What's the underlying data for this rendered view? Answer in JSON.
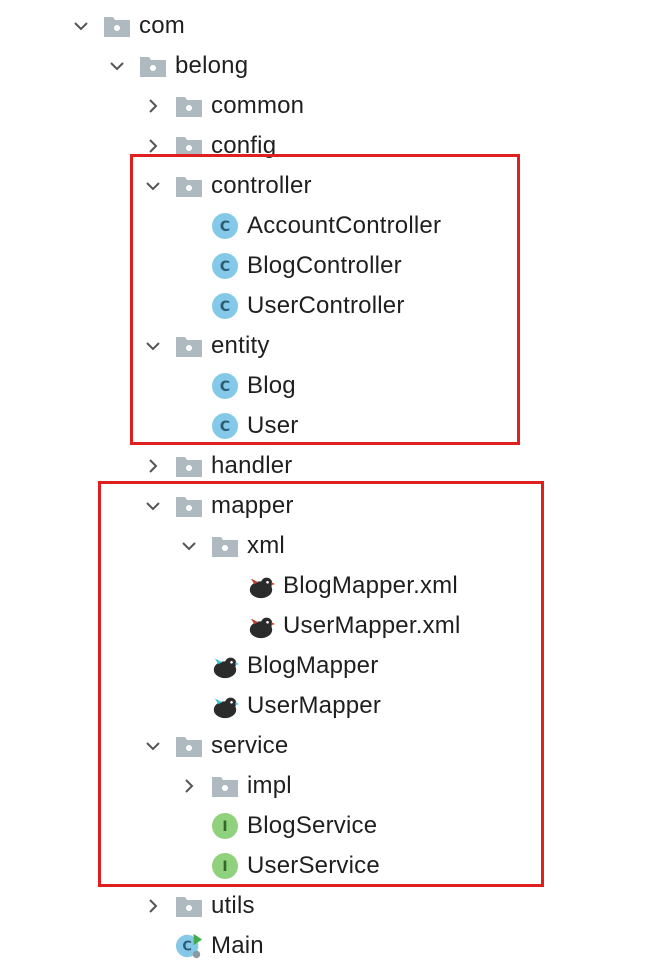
{
  "tree": {
    "items": [
      {
        "label": "com",
        "kind": "folder",
        "expanded": true
      },
      {
        "label": "belong",
        "kind": "folder",
        "expanded": true
      },
      {
        "label": "common",
        "kind": "folder",
        "expanded": false
      },
      {
        "label": "config",
        "kind": "folder",
        "expanded": false
      },
      {
        "label": "controller",
        "kind": "folder",
        "expanded": true
      },
      {
        "label": "AccountController",
        "kind": "class"
      },
      {
        "label": "BlogController",
        "kind": "class"
      },
      {
        "label": "UserController",
        "kind": "class"
      },
      {
        "label": "entity",
        "kind": "folder",
        "expanded": true
      },
      {
        "label": "Blog",
        "kind": "class"
      },
      {
        "label": "User",
        "kind": "class"
      },
      {
        "label": "handler",
        "kind": "folder",
        "expanded": false
      },
      {
        "label": "mapper",
        "kind": "folder",
        "expanded": true
      },
      {
        "label": "xml",
        "kind": "folder",
        "expanded": true
      },
      {
        "label": "BlogMapper.xml",
        "kind": "mybatis-xml"
      },
      {
        "label": "UserMapper.xml",
        "kind": "mybatis-xml"
      },
      {
        "label": "BlogMapper",
        "kind": "mybatis-mapper"
      },
      {
        "label": "UserMapper",
        "kind": "mybatis-mapper"
      },
      {
        "label": "service",
        "kind": "folder",
        "expanded": true
      },
      {
        "label": "impl",
        "kind": "folder",
        "expanded": false
      },
      {
        "label": "BlogService",
        "kind": "interface"
      },
      {
        "label": "UserService",
        "kind": "interface"
      },
      {
        "label": "utils",
        "kind": "folder",
        "expanded": false
      },
      {
        "label": "Main",
        "kind": "main-class"
      }
    ]
  },
  "icons": {
    "class_glyph": "C",
    "interface_glyph": "I"
  },
  "colors": {
    "folder": "#aeb9c0",
    "class_icon": "#85c9e8",
    "interface_icon": "#8fd17c",
    "highlight": "#e02020",
    "text": "#1f1f1f"
  }
}
